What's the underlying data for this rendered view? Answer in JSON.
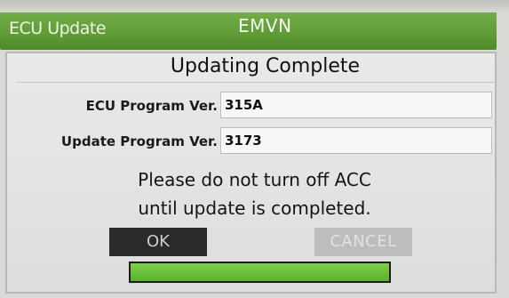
{
  "title_bar": {
    "app_title": "ECU Update",
    "code": "EMVN"
  },
  "dialog": {
    "heading": "Updating Complete",
    "fields": [
      {
        "label": "ECU Program Ver.",
        "value": "315A"
      },
      {
        "label": "Update Program Ver.",
        "value": "3173"
      }
    ],
    "message_line1": "Please do not turn off ACC",
    "message_line2": "until update is completed.",
    "ok_label": "OK",
    "cancel_label": "CANCEL",
    "progress_fraction": 1.0
  },
  "colors": {
    "title_bar": "#5e9b35",
    "progress": "#6cc23a",
    "ok_button": "#2a2a2a",
    "cancel_button_disabled": "#bdbdbb"
  }
}
